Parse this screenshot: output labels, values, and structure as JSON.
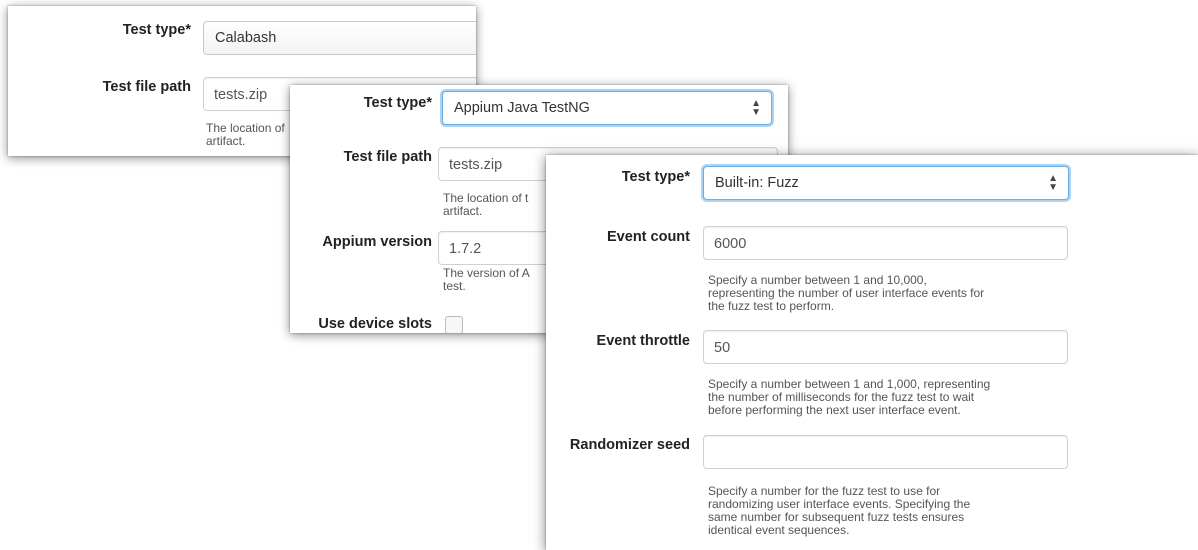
{
  "calabash_form": {
    "test_type": {
      "label": "Test type*",
      "value": "Calabash"
    },
    "test_file_path": {
      "label": "Test file path",
      "value": "tests.zip",
      "help": "The location of\nartifact."
    }
  },
  "appium_form": {
    "test_type": {
      "label": "Test type*",
      "value": "Appium Java TestNG"
    },
    "test_file_path": {
      "label": "Test file path",
      "value": "tests.zip",
      "help": "The location of t\nartifact."
    },
    "appium_version": {
      "label": "Appium version",
      "value": "1.7.2",
      "help": "The version of A\ntest."
    },
    "use_device_slots": {
      "label": "Use device slots",
      "checked": false
    }
  },
  "fuzz_form": {
    "test_type": {
      "label": "Test type*",
      "value": "Built-in: Fuzz"
    },
    "event_count": {
      "label": "Event count",
      "value": "6000",
      "help": "Specify a number between 1 and 10,000,\nrepresenting the number of user interface events for\nthe fuzz test to perform."
    },
    "event_throttle": {
      "label": "Event throttle",
      "value": "50",
      "help": "Specify a number between 1 and 1,000, representing\nthe number of milliseconds for the fuzz test to wait\nbefore performing the next user interface event."
    },
    "randomizer_seed": {
      "label": "Randomizer seed",
      "value": "",
      "help": "Specify a number for the fuzz test to use for\nrandomizing user interface events. Specifying the\nsame number for subsequent fuzz tests ensures\nidentical event sequences."
    }
  },
  "icons": {
    "select_caret": "updown-caret-icon"
  },
  "colors": {
    "focus_border": "#66afe9",
    "label_text": "#222222",
    "help_text": "#555555"
  }
}
